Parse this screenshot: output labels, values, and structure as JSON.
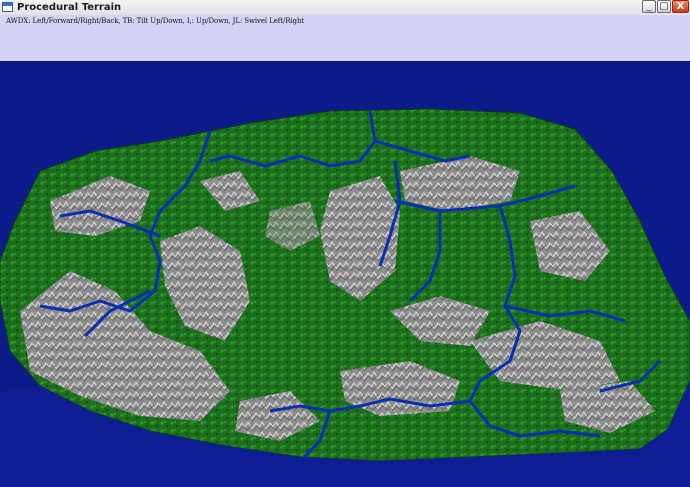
{
  "window": {
    "title": "Procedural Terrain",
    "icon": "app-window-icon",
    "controls": {
      "minimize": "_",
      "maximize": "□",
      "close": "X"
    }
  },
  "hint": "AWDX: Left/Forward/Right/Back, TB: Tilt Up/Down, I,: Up/Down, JL: Swivel Left/Right",
  "colors": {
    "background_sky": "#d3d4f8",
    "ocean": "#0c1a8a",
    "terrain_green": "#1f7a1e",
    "terrain_rock": "#9c9c9c",
    "rivers": "#0a2fae"
  }
}
